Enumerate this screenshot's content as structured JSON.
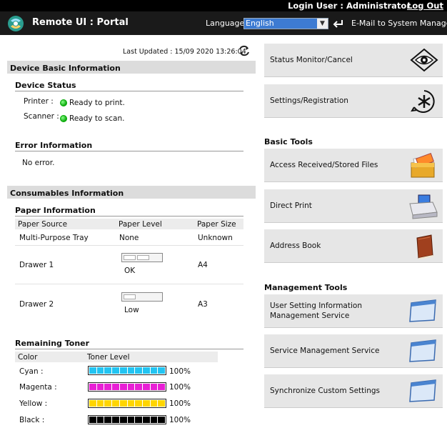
{
  "topbar": {
    "login": "Login User : Administrator",
    "logout": "Log Out"
  },
  "header": {
    "title": "Remote UI : Portal",
    "language_label": "Language:",
    "language_value": "English",
    "email_link": "E-Mail to System Manager"
  },
  "left": {
    "last_updated": "Last Updated : 15/09 2020 13:26:04",
    "device_basic": {
      "title": "Device Basic Information",
      "status_title": "Device Status",
      "printer_label": "Printer :",
      "printer_status": "Ready to print.",
      "scanner_label": "Scanner :",
      "scanner_status": "Ready to scan."
    },
    "error": {
      "title": "Error Information",
      "text": "No error."
    },
    "consumables": {
      "title": "Consumables Information",
      "paper": {
        "title": "Paper Information",
        "headers": [
          "Paper Source",
          "Paper Level",
          "Paper Size"
        ],
        "rows": [
          {
            "source": "Multi-Purpose Tray",
            "level": "None",
            "size": "Unknown"
          },
          {
            "source": "Drawer 1",
            "level": "OK",
            "size": "A4",
            "fill": 0.67
          },
          {
            "source": "Drawer 2",
            "level": "Low",
            "size": "A3",
            "fill": 0.33
          }
        ]
      },
      "toner": {
        "title": "Remaining Toner",
        "headers": [
          "Color",
          "Toner Level"
        ],
        "rows": [
          {
            "color": "Cyan :",
            "pct": "100%",
            "hex": "#22c4f2"
          },
          {
            "color": "Magenta :",
            "pct": "100%",
            "hex": "#e81fd5"
          },
          {
            "color": "Yellow :",
            "pct": "100%",
            "hex": "#ffd500"
          },
          {
            "color": "Black :",
            "pct": "100%",
            "hex": "#000000"
          }
        ]
      }
    }
  },
  "right": {
    "status_monitor": "Status Monitor/Cancel",
    "settings": "Settings/Registration",
    "basic_tools_title": "Basic Tools",
    "access_files": "Access Received/Stored Files",
    "direct_print": "Direct Print",
    "address_book": "Address Book",
    "management_title": "Management Tools",
    "user_setting": "User Setting Information Management Service",
    "service_mgmt": "Service Management Service",
    "sync_custom": "Synchronize Custom Settings"
  }
}
